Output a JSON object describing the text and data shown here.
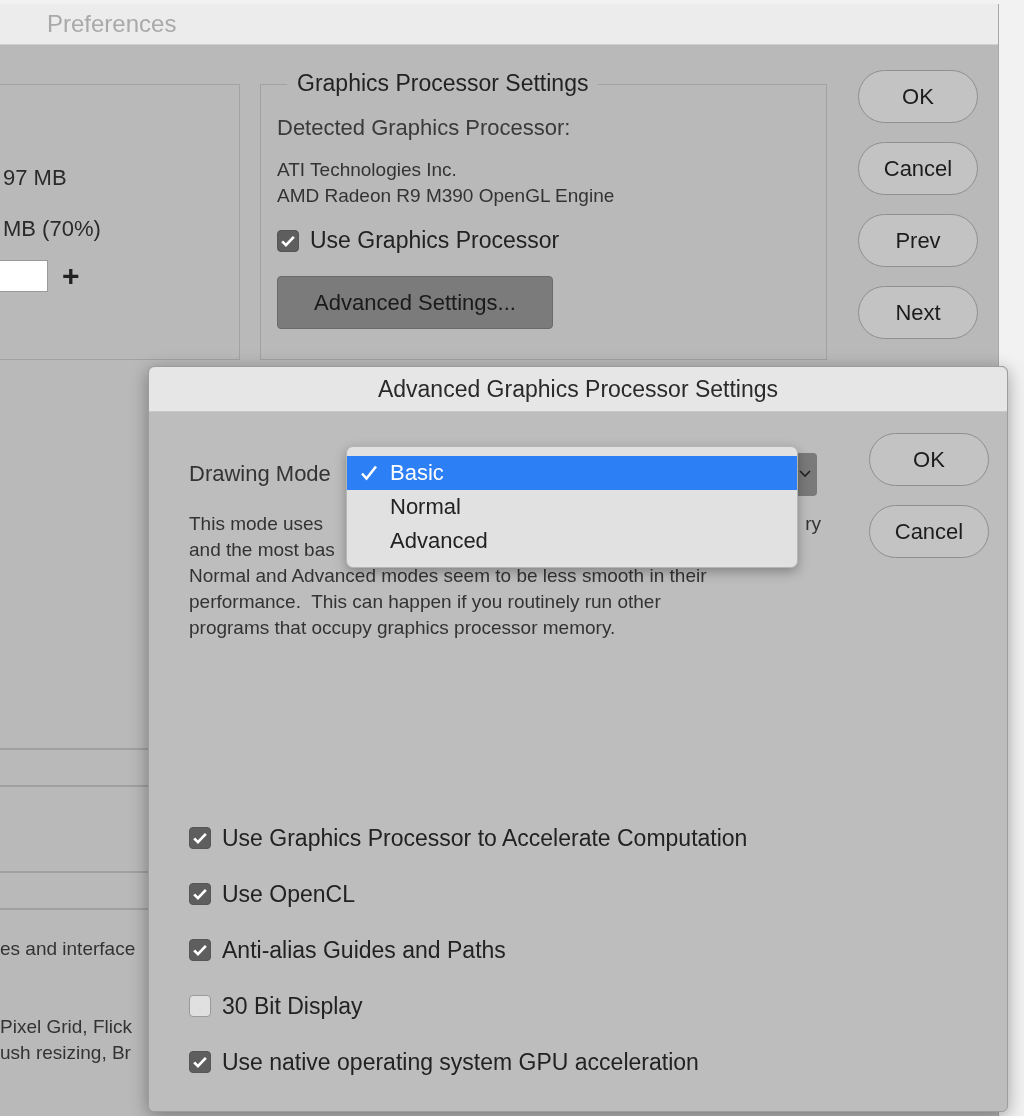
{
  "preferences_window": {
    "title": "Preferences",
    "memory_panel": {
      "texts": [
        "97 MB",
        "MB (70%)"
      ],
      "plus_button": "+"
    },
    "gpu_settings": {
      "legend": "Graphics Processor Settings",
      "detected_label": "Detected Graphics Processor:",
      "vendor": "ATI Technologies Inc.",
      "renderer": "AMD Radeon R9 M390 OpenGL Engine",
      "use_gpu": {
        "label": "Use Graphics Processor",
        "checked": true
      },
      "advanced_button": "Advanced Settings..."
    },
    "buttons": [
      "OK",
      "Cancel",
      "Prev",
      "Next"
    ],
    "lower_texts": [
      "es and interface",
      "Pixel Grid, Flick",
      "ush resizing, Br"
    ]
  },
  "dialog": {
    "title": "Advanced Graphics Processor Settings",
    "drawing_mode_label": "Drawing Mode",
    "drawing_mode_menu": [
      {
        "label": "Basic",
        "selected": true
      },
      {
        "label": "Normal",
        "selected": false
      },
      {
        "label": "Advanced",
        "selected": false
      }
    ],
    "description": {
      "line_1_start": "This mode uses",
      "line_1_end": "ry",
      "line_2_start": "and the most bas",
      "lines": [
        "Normal and Advanced modes seem to be less smooth in their",
        "performance.  This can happen if you routinely run other",
        "programs that occupy graphics processor memory."
      ]
    },
    "buttons": [
      "OK",
      "Cancel"
    ],
    "options": [
      {
        "label": "Use Graphics Processor to Accelerate Computation",
        "checked": true
      },
      {
        "label": "Use OpenCL",
        "checked": true
      },
      {
        "label": "Anti-alias Guides and Paths",
        "checked": true
      },
      {
        "label": "30 Bit Display",
        "checked": false
      },
      {
        "label": "Use native operating system GPU acceleration",
        "checked": true
      }
    ]
  }
}
